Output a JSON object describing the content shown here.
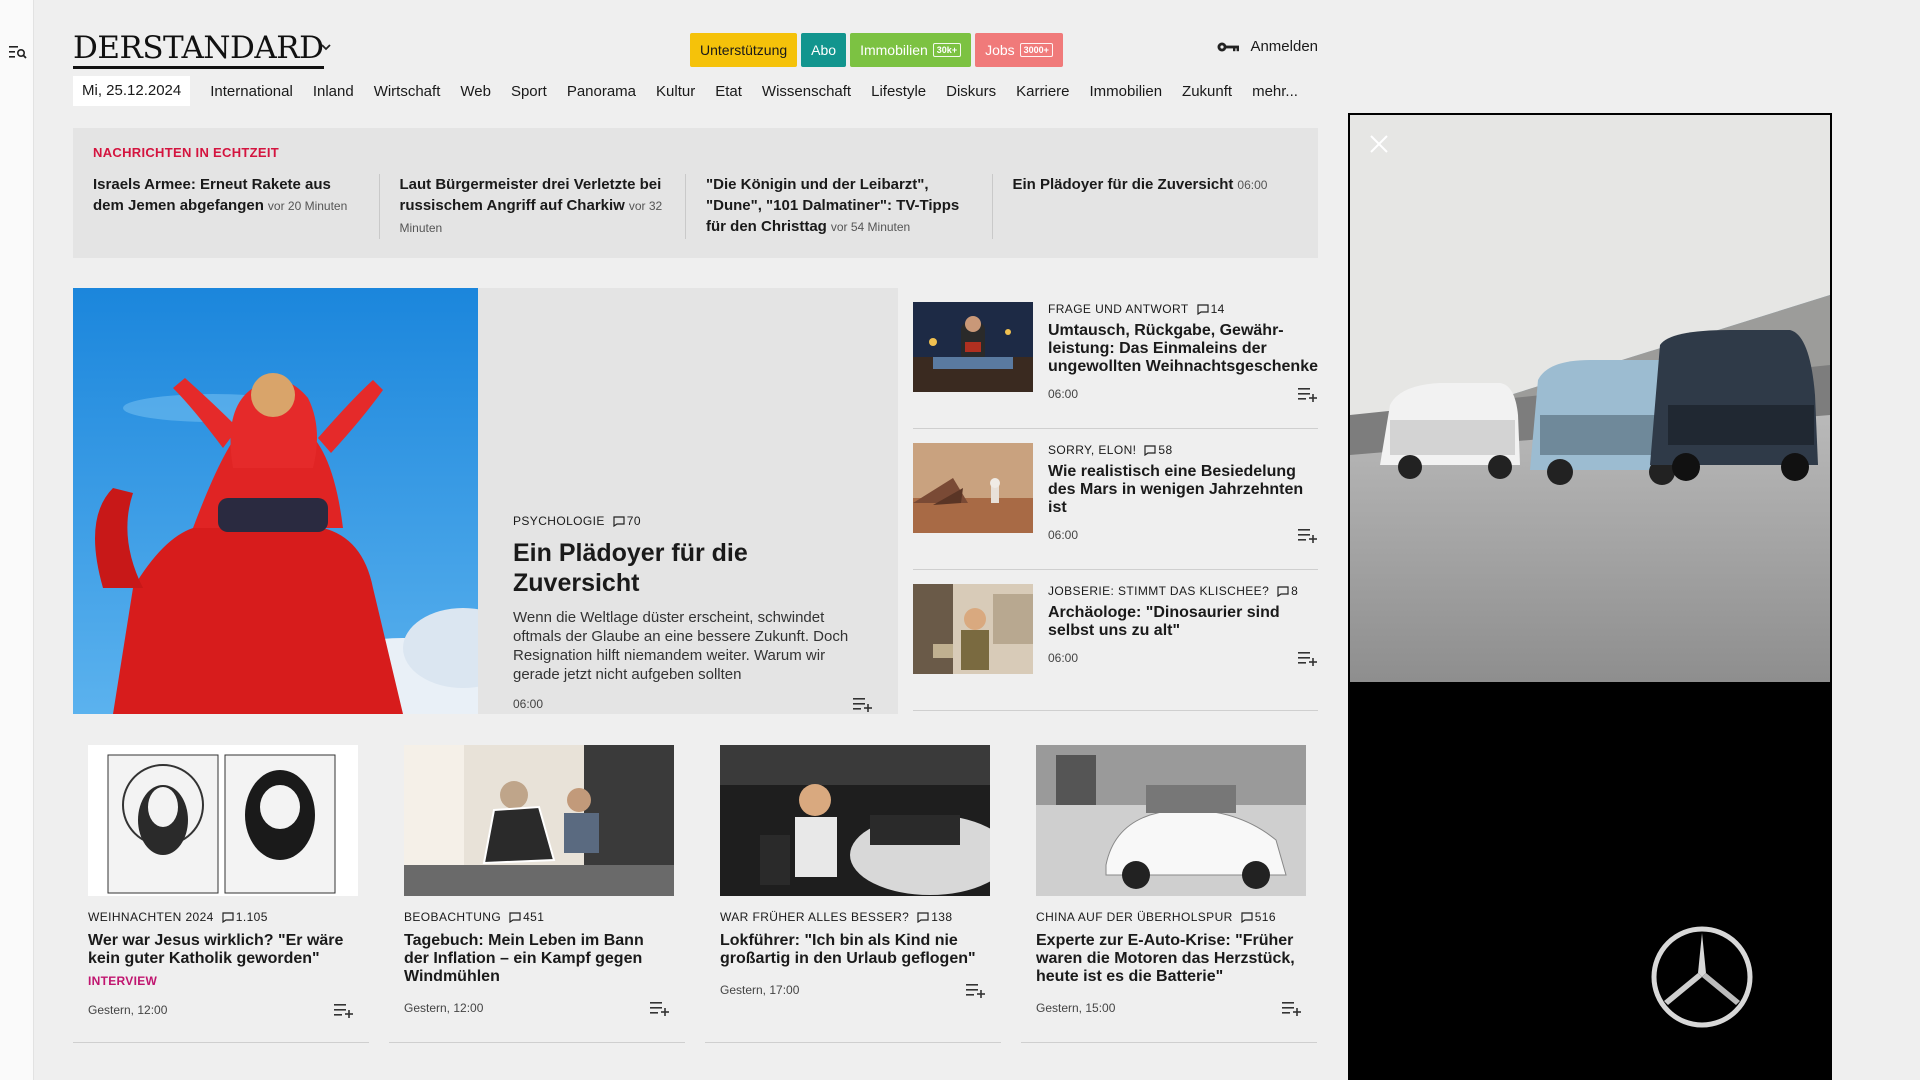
{
  "header": {
    "logo": "DERSTANDARD",
    "pills": [
      {
        "label": "Unterstützung",
        "bg": "#f5c20a",
        "color": "#1a1a1a",
        "badge": ""
      },
      {
        "label": "Abo",
        "bg": "#12958e",
        "color": "#ffffff",
        "badge": ""
      },
      {
        "label": "Immobilien",
        "bg": "#7cc242",
        "color": "#ffffff",
        "badge": "30k+"
      },
      {
        "label": "Jobs",
        "bg": "#f07a7a",
        "color": "#ffffff",
        "badge": "3000+"
      }
    ],
    "login_label": "Anmelden"
  },
  "nav": {
    "date": "Mi, 25.12.2024",
    "items": [
      "International",
      "Inland",
      "Wirtschaft",
      "Web",
      "Sport",
      "Panorama",
      "Kultur",
      "Etat",
      "Wissenschaft",
      "Lifestyle",
      "Diskurs",
      "Karriere",
      "Immobilien",
      "Zukunft",
      "mehr..."
    ]
  },
  "ticker": {
    "title": "Nachrichten in Echtzeit",
    "items": [
      {
        "headline": "Israels Armee: Erneut Rakete aus dem Jemen abgefangen",
        "time": "vor 20 Minuten"
      },
      {
        "headline": "Laut Bürgermeister drei Verletzte bei russischem Angriff auf Charkiw",
        "time": "vor 32 Minuten"
      },
      {
        "headline": "\"Die Königin und der Leibarzt\", \"Dune\", \"101 Dalmatiner\": TV-Tipps für den Christtag",
        "time": "vor 54 Minuten"
      },
      {
        "headline": "Ein Plädoyer für die Zuversicht",
        "time": "06:00"
      }
    ]
  },
  "hero": {
    "kicker": "Psychologie",
    "comments": "70",
    "title": "Ein Plädoyer für die Zuversicht",
    "teaser": "Wenn die Weltlage düster erscheint, schwindet oftmals der Glaube an eine bessere Zukunft. Doch Resignation hilft niemandem weiter. Warum wir gerade jetzt nicht aufgeben sollten",
    "time": "06:00"
  },
  "side": [
    {
      "kicker": "Frage und Antwort",
      "comments": "14",
      "title": "Umtausch, Rückgabe, Gewähr­leistung: Das Einmaleins der ungewollten Weihnachtsge­schenke",
      "time": "06:00"
    },
    {
      "kicker": "Sorry, Elon!",
      "comments": "58",
      "title": "Wie realistisch eine Besiedelung des Mars in wenigen Jahrzehnten ist",
      "time": "06:00"
    },
    {
      "kicker": "Jobserie: Stimmt das Klischee?",
      "comments": "8",
      "title": "Archäologe: \"Dinosaurier sind selbst uns zu alt\"",
      "time": "06:00"
    }
  ],
  "cards": [
    {
      "kicker": "Weihnachten 2024",
      "comments": "1.105",
      "title": "Wer war Jesus wirklich? \"Er wäre kein guter Katholik geworden\"",
      "label": "Interview",
      "time": "Gestern, 12:00"
    },
    {
      "kicker": "Beobachtung",
      "comments": "451",
      "title": "Tagebuch: Mein Leben im Bann der Inflation – ein Kampf gegen Windmühlen",
      "label": "",
      "time": "Gestern, 12:00"
    },
    {
      "kicker": "War früher alles besser?",
      "comments": "138",
      "title": "Lokführer: \"Ich bin als Kind nie großartig in den Urlaub geflogen\"",
      "label": "",
      "time": "Gestern, 17:00"
    },
    {
      "kicker": "China auf der Überholspur",
      "comments": "516",
      "title": "Experte zur E-Auto-Krise: \"Früher waren die Motoren das Herzstück, heute ist es die Batterie\"",
      "label": "",
      "time": "Gestern, 15:00"
    }
  ],
  "icons": {
    "menu": "menu-search-icon",
    "login": "key-icon",
    "comment": "comment-icon",
    "add_to_list": "add-to-list-icon",
    "close": "close-icon",
    "chevron": "chevron-down-icon"
  },
  "colors": {
    "ticker_title": "#d4143f",
    "interview_label": "#c0156f"
  }
}
